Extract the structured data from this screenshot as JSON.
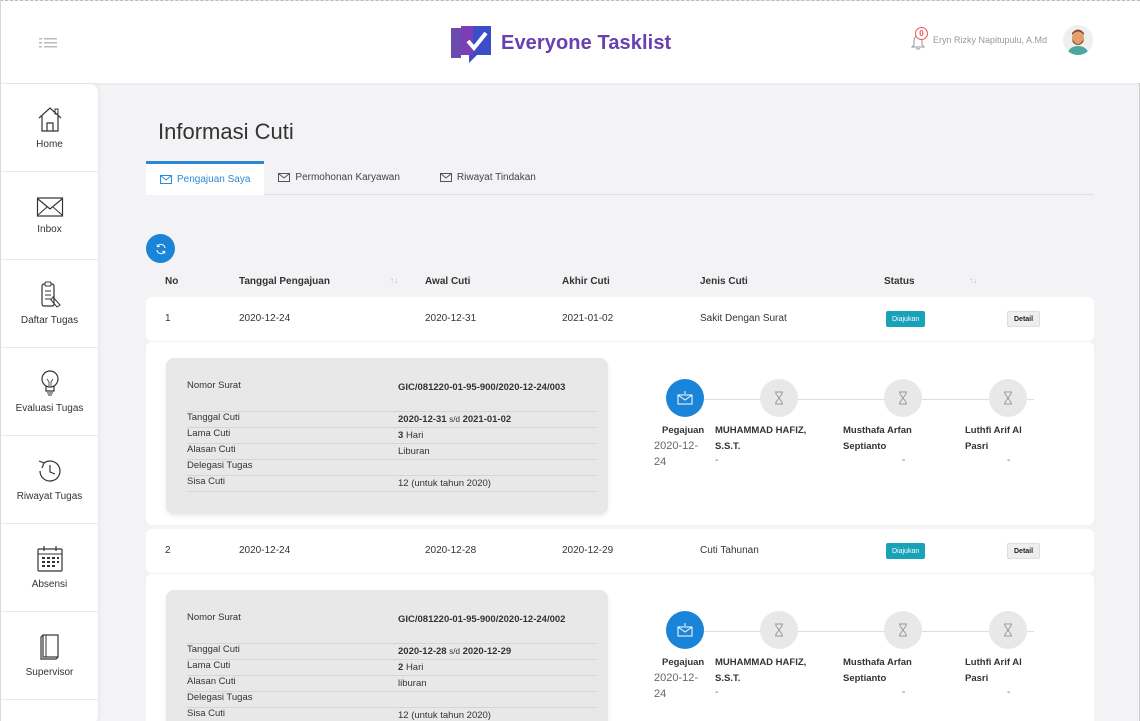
{
  "header": {
    "brand_title": "Everyone Tasklist",
    "notification_count": "0",
    "user_name": "Eryn Rizky Napitupulu, A.Md",
    "brand_color": "#6a3fb0"
  },
  "sidebar": {
    "items": [
      {
        "label": "Home",
        "icon": "home-icon"
      },
      {
        "label": "Inbox",
        "icon": "envelope-icon"
      },
      {
        "label": "Daftar Tugas",
        "icon": "clipboard-list-icon"
      },
      {
        "label": "Evaluasi Tugas",
        "icon": "lightbulb-icon"
      },
      {
        "label": "Riwayat Tugas",
        "icon": "history-clock-icon"
      },
      {
        "label": "Absensi",
        "icon": "calendar-icon"
      },
      {
        "label": "Supervisor",
        "icon": "book-icon"
      }
    ]
  },
  "main": {
    "title": "Informasi Cuti",
    "tabs": [
      {
        "label": "Pengajuan Saya",
        "active": true
      },
      {
        "label": "Permohonan Karyawan",
        "active": false
      },
      {
        "label": "Riwayat Tindakan",
        "active": false
      }
    ],
    "table": {
      "headers": [
        "No",
        "Tanggal Pengajuan",
        "Awal Cuti",
        "Akhir Cuti",
        "Jenis Cuti",
        "Status"
      ],
      "sort_glyph": "↑↓",
      "status_color": "#17a2b8",
      "detail_label": "Detail",
      "rows": [
        {
          "no": "1",
          "tanggal_pengajuan": "2020-12-24",
          "awal_cuti": "2020-12-31",
          "akhir_cuti": "2021-01-02",
          "jenis_cuti": "Sakit Dengan Surat",
          "status": "Diajukan",
          "detail": {
            "nomor_surat_label": "Nomor Surat",
            "nomor_surat": "GIC/081220-01-95-900/2020-12-24/003",
            "tanggal_cuti_label": "Tanggal Cuti",
            "tanggal_awal": "2020-12-31",
            "sd": "s/d",
            "tanggal_akhir": "2021-01-02",
            "lama_cuti_label": "Lama Cuti",
            "lama_cuti": "3",
            "hari": "Hari",
            "alasan_label": "Alasan Cuti",
            "alasan": "Liburan",
            "delegasi_label": "Delegasi Tugas",
            "delegasi": "",
            "sisa_label": "Sisa Cuti",
            "sisa": "12 (untuk tahun 2020)"
          },
          "timeline": [
            {
              "name": "Pegajuan",
              "date": "2020-12-24",
              "icon": "mail-icon",
              "active": true
            },
            {
              "name": "MUHAMMAD HAFIZ, S.S.T.",
              "date": "-",
              "icon": "hourglass-icon",
              "active": false
            },
            {
              "name": "Musthafa Arfan Septianto",
              "date": "-",
              "icon": "hourglass-icon",
              "active": false
            },
            {
              "name": "Luthfi Arif Al Pasri",
              "date": "-",
              "icon": "hourglass-icon",
              "active": false
            }
          ]
        },
        {
          "no": "2",
          "tanggal_pengajuan": "2020-12-24",
          "awal_cuti": "2020-12-28",
          "akhir_cuti": "2020-12-29",
          "jenis_cuti": "Cuti Tahunan",
          "status": "Diajukan",
          "detail": {
            "nomor_surat_label": "Nomor Surat",
            "nomor_surat": "GIC/081220-01-95-900/2020-12-24/002",
            "tanggal_cuti_label": "Tanggal Cuti",
            "tanggal_awal": "2020-12-28",
            "sd": "s/d",
            "tanggal_akhir": "2020-12-29",
            "lama_cuti_label": "Lama Cuti",
            "lama_cuti": "2",
            "hari": "Hari",
            "alasan_label": "Alasan Cuti",
            "alasan": "liburan",
            "delegasi_label": "Delegasi Tugas",
            "delegasi": "",
            "sisa_label": "Sisa Cuti",
            "sisa": "12 (untuk tahun 2020)"
          },
          "timeline": [
            {
              "name": "Pegajuan",
              "date": "2020-12-24",
              "icon": "mail-icon",
              "active": true
            },
            {
              "name": "MUHAMMAD HAFIZ, S.S.T.",
              "date": "-",
              "icon": "hourglass-icon",
              "active": false
            },
            {
              "name": "Musthafa Arfan Septianto",
              "date": "-",
              "icon": "hourglass-icon",
              "active": false
            },
            {
              "name": "Luthfi Arif Al Pasri",
              "date": "-",
              "icon": "hourglass-icon",
              "active": false
            }
          ]
        }
      ]
    }
  }
}
